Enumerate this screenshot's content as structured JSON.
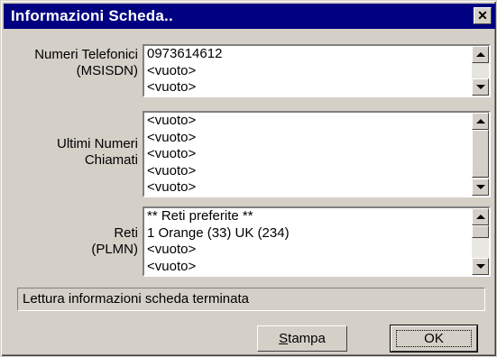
{
  "window": {
    "title": "Informazioni Scheda..",
    "close_glyph": "✕"
  },
  "msisdn": {
    "label_line1": "Numeri Telefonici",
    "label_line2": "(MSISDN)",
    "items": [
      "0973614612",
      "<vuoto>",
      "<vuoto>"
    ]
  },
  "last_called": {
    "label_line1": "Ultimi Numeri",
    "label_line2": "Chiamati",
    "items": [
      "<vuoto>",
      "<vuoto>",
      "<vuoto>",
      "<vuoto>",
      "<vuoto>"
    ]
  },
  "networks": {
    "label_line1": "Reti",
    "label_line2": "(PLMN)",
    "items": [
      "** Reti preferite **",
      "1 Orange (33) UK (234)",
      "<vuoto>",
      "<vuoto>"
    ]
  },
  "status": {
    "text": "Lettura informazioni scheda terminata"
  },
  "buttons": {
    "print_prefix": "S",
    "print_rest": "tampa",
    "ok": "OK"
  }
}
